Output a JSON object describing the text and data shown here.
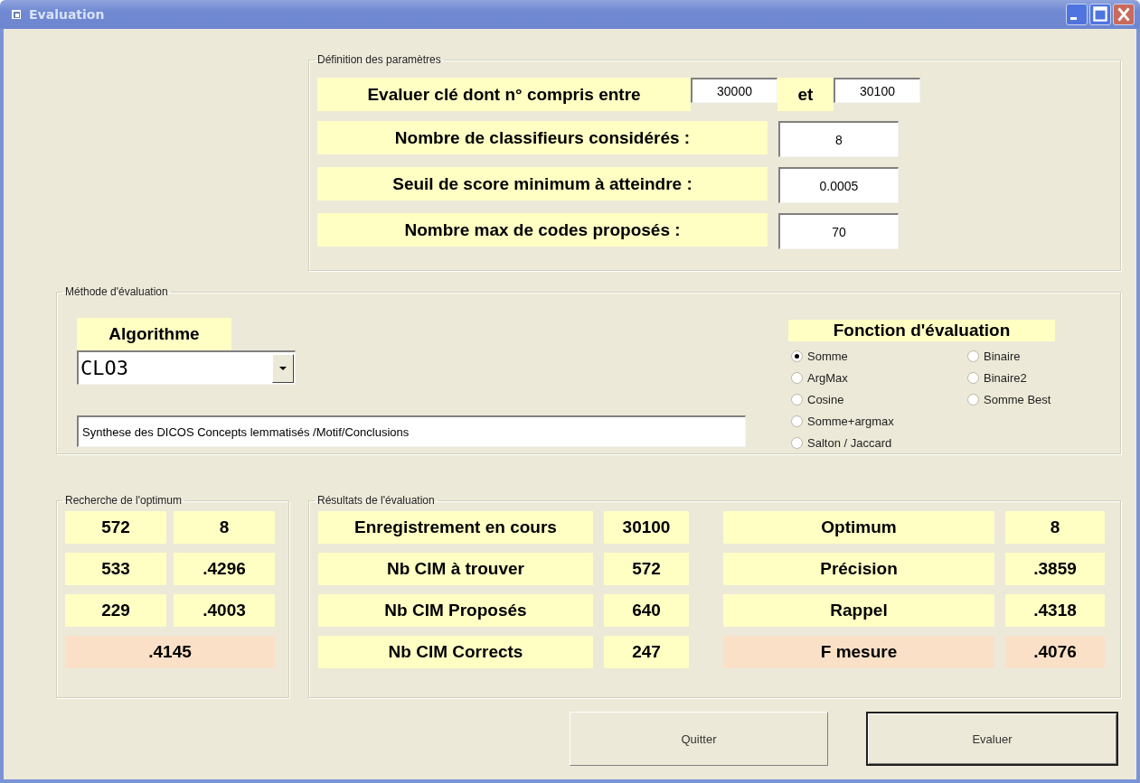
{
  "window": {
    "title": "Evaluation"
  },
  "parametres": {
    "title": "Définition des paramètres",
    "range": {
      "label": "Evaluer clé dont n° compris entre",
      "from": "30000",
      "joiner": "et",
      "to": "30100"
    },
    "fields": [
      {
        "label": "Nombre de classifieurs considérés :",
        "value": "8"
      },
      {
        "label": "Seuil de score minimum à atteindre :",
        "value": "0.0005"
      },
      {
        "label": "Nombre max de codes proposés :",
        "value": "70"
      }
    ]
  },
  "methode": {
    "title": "Méthode d'évaluation",
    "algorithm_label": "Algorithme",
    "algorithm": "CLO3",
    "description": "Synthese des DICOS Concepts lemmatisés /Motif/Conclusions",
    "function_label": "Fonction d'évaluation",
    "options": [
      {
        "label": "Somme",
        "selected": true
      },
      {
        "label": "ArgMax",
        "selected": false
      },
      {
        "label": "Cosine",
        "selected": false
      },
      {
        "label": "Somme+argmax",
        "selected": false
      },
      {
        "label": "Salton / Jaccard",
        "selected": false
      },
      {
        "label": "Binaire",
        "selected": false
      },
      {
        "label": "Binaire2",
        "selected": false
      },
      {
        "label": "Somme Best",
        "selected": false
      }
    ]
  },
  "recherche": {
    "title": "Recherche de l'optimum",
    "rows": [
      [
        "572",
        "8"
      ],
      [
        "533",
        ".4296"
      ],
      [
        "229",
        ".4003"
      ]
    ],
    "total": ".4145"
  },
  "resultats": {
    "title": "Résultats de l'évaluation",
    "rows": [
      {
        "label": "Enregistrement en cours",
        "value": "30100",
        "label_2": "Optimum",
        "value_2": "8",
        "highlight": false
      },
      {
        "label": "Nb CIM à trouver",
        "value": "572",
        "label_2": "Précision",
        "value_2": ".3859",
        "highlight": false
      },
      {
        "label": "Nb CIM Proposés",
        "value": "640",
        "label_2": "Rappel",
        "value_2": ".4318",
        "highlight": false
      },
      {
        "label": "Nb CIM Corrects",
        "value": "247",
        "label_2": "F mesure",
        "value_2": ".4076",
        "highlight": true
      }
    ]
  },
  "buttons": [
    {
      "label": "Quitter",
      "default": false
    },
    {
      "label": "Evaluer",
      "default": true
    }
  ]
}
